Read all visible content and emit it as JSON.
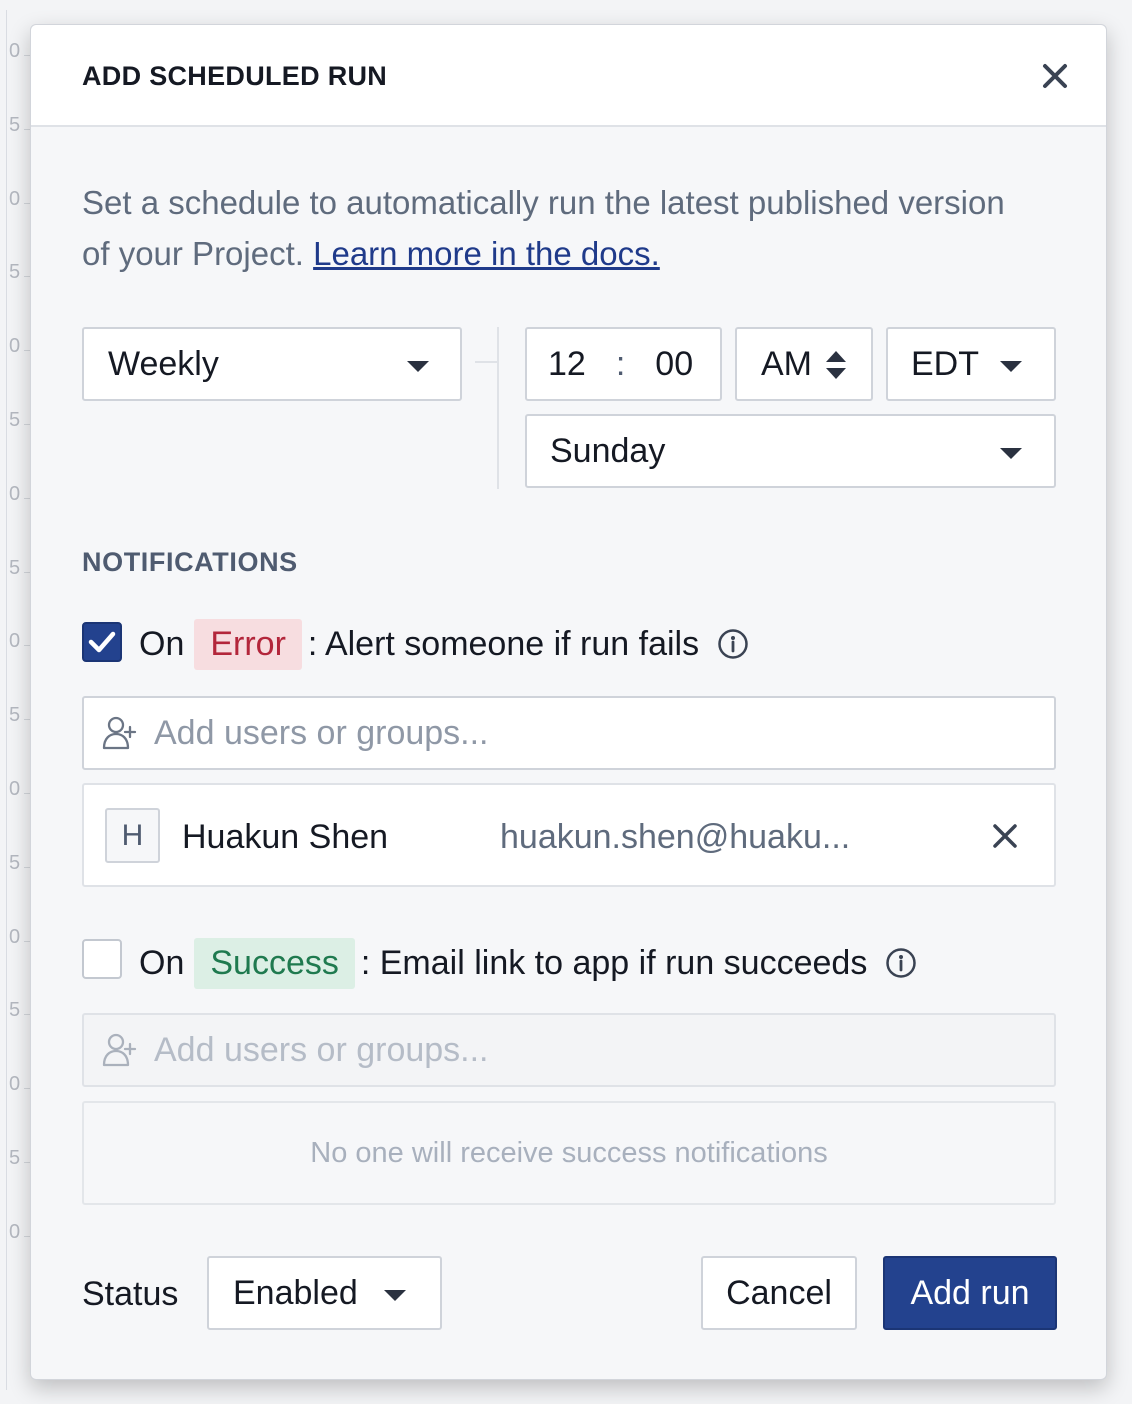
{
  "background_ticks": [
    "0",
    "5",
    "0",
    "5",
    "0",
    "5",
    "0",
    "5",
    "0",
    "5",
    "0",
    "5",
    "0",
    "5",
    "0",
    "5",
    "0"
  ],
  "dialog": {
    "title": "ADD SCHEDULED RUN",
    "description": "Set a schedule to automatically run the latest published version of your Project.",
    "docs_link": "Learn more in the docs."
  },
  "schedule": {
    "frequency": "Weekly",
    "hour": "12",
    "separator": ":",
    "minute": "00",
    "ampm": "AM",
    "timezone": "EDT",
    "day": "Sunday"
  },
  "notifications": {
    "title": "NOTIFICATIONS",
    "error": {
      "checked": true,
      "prefix": "On",
      "tag": "Error",
      "text": ": Alert someone if run fails",
      "placeholder": "Add users or groups...",
      "users": [
        {
          "initial": "H",
          "name": "Huakun Shen",
          "email": "huakun.shen@huaku..."
        }
      ]
    },
    "success": {
      "checked": false,
      "prefix": "On",
      "tag": "Success",
      "text": ": Email link to app if run succeeds",
      "placeholder": "Add users or groups...",
      "empty_message": "No one will receive success notifications"
    }
  },
  "footer": {
    "status_label": "Status",
    "status_value": "Enabled",
    "cancel_label": "Cancel",
    "submit_label": "Add run"
  },
  "colors": {
    "primary": "#23428e",
    "error_tag_bg": "#f7dde0",
    "error_tag_text": "#b3263b",
    "success_tag_bg": "#dcefe5",
    "success_tag_text": "#1f7a4f"
  }
}
